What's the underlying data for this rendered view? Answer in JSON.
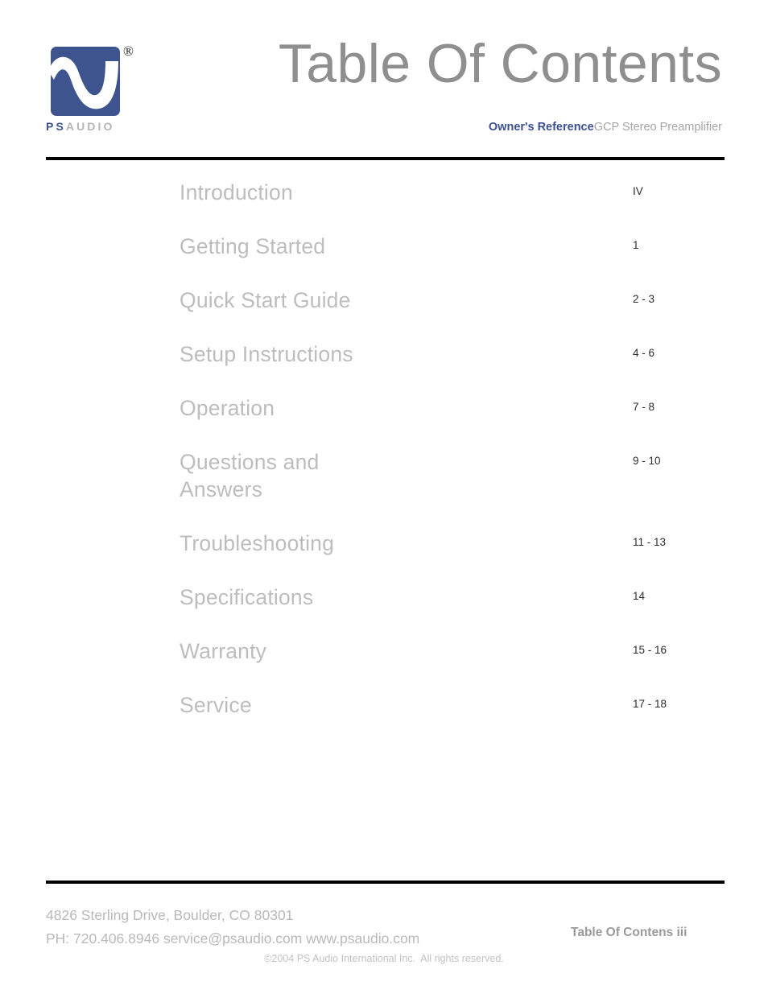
{
  "document": {
    "title": "Table Of Contents",
    "subtitle_bold": "Owner's Reference",
    "subtitle_regular": "GCP Stereo Preamplifier"
  },
  "brand": {
    "logo_icon": "ps-audio-wave-logo",
    "registered_symbol": "®",
    "name_ps": "PS",
    "name_audio": "AUDIO",
    "logo_color": "#3d548f"
  },
  "toc": {
    "entries": [
      {
        "label": "Introduction",
        "page": "IV",
        "multiline": false
      },
      {
        "label": "Getting Started",
        "page": "1",
        "multiline": false
      },
      {
        "label": "Quick Start Guide",
        "page": "2 - 3",
        "multiline": false
      },
      {
        "label": "Setup Instructions",
        "page": "4 - 6",
        "multiline": false
      },
      {
        "label": "Operation",
        "page": "7 - 8",
        "multiline": false
      },
      {
        "label": "Questions and\nAnswers",
        "page": "9 - 10",
        "multiline": true
      },
      {
        "label": "Troubleshooting",
        "page": "11 - 13",
        "multiline": false
      },
      {
        "label": "Specifications",
        "page": "14",
        "multiline": false
      },
      {
        "label": "Warranty",
        "page": "15 - 16",
        "multiline": false
      },
      {
        "label": "Service",
        "page": "17 - 18",
        "multiline": false
      }
    ]
  },
  "footer": {
    "address_line1": "4826 Sterling Drive, Boulder, CO 80301",
    "address_line2": "PH: 720.406.8946 service@psaudio.com www.psaudio.com",
    "page_mark": "Table Of Contens iii",
    "copyright": "©2004 PS Audio International Inc.  All rights reserved."
  }
}
